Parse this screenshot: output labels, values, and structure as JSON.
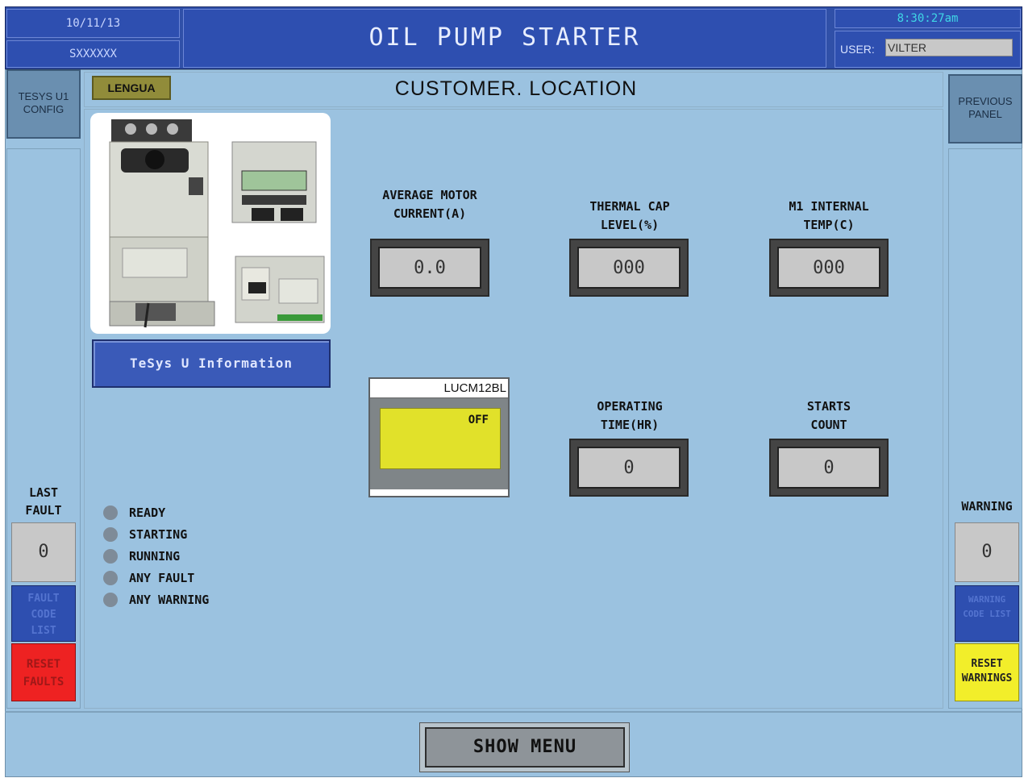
{
  "header": {
    "date": "10/11/13",
    "serial": "SXXXXXX",
    "title": "OIL PUMP STARTER",
    "time": "8:30:27am",
    "user_label": "USER:",
    "user_value": "VILTER"
  },
  "subheader": {
    "lengua_button": "LENGUA",
    "location": "CUSTOMER. LOCATION"
  },
  "left_sidebar": {
    "config_button": "TESYS U1 CONFIG",
    "last_fault_label_1": "LAST",
    "last_fault_label_2": "FAULT",
    "last_fault_value": "0",
    "fault_code_list_button": "FAULT CODE LIST",
    "reset_faults_button": "RESET FAULTS"
  },
  "right_sidebar": {
    "previous_panel_button": "PREVIOUS PANEL",
    "warning_label": "WARNING",
    "warning_value": "0",
    "warning_code_list_button": "WARNING CODE LIST",
    "reset_warnings_button": "RESET WARNINGS"
  },
  "info_button": "TeSys U Information",
  "readouts": {
    "avg_motor_current": {
      "label1": "AVERAGE MOTOR",
      "label2": "CURRENT(A)",
      "value": "0.0"
    },
    "thermal_cap": {
      "label1": "THERMAL CAP",
      "label2": "LEVEL(%)",
      "value": "000"
    },
    "internal_temp": {
      "label1": "M1 INTERNAL",
      "label2": "TEMP(C)",
      "value": "000"
    },
    "operating_time": {
      "label1": "OPERATING",
      "label2": "TIME(HR)",
      "value": "0"
    },
    "starts_count": {
      "label1": "STARTS",
      "label2": "COUNT",
      "value": "0"
    }
  },
  "module": {
    "model": "LUCM12BL",
    "state": "OFF"
  },
  "status_leds": [
    "READY",
    "STARTING",
    "RUNNING",
    "ANY FAULT",
    "ANY WARNING"
  ],
  "footer": {
    "show_menu_button": "SHOW MENU"
  },
  "colors": {
    "header_blue": "#2e4fb0",
    "panel_bg": "#9bc2e0",
    "reset_faults_red": "#ee2222",
    "reset_warnings_yellow": "#f2ee2a",
    "module_yellow": "#e1e12a",
    "time_text": "#3fd7e6"
  }
}
